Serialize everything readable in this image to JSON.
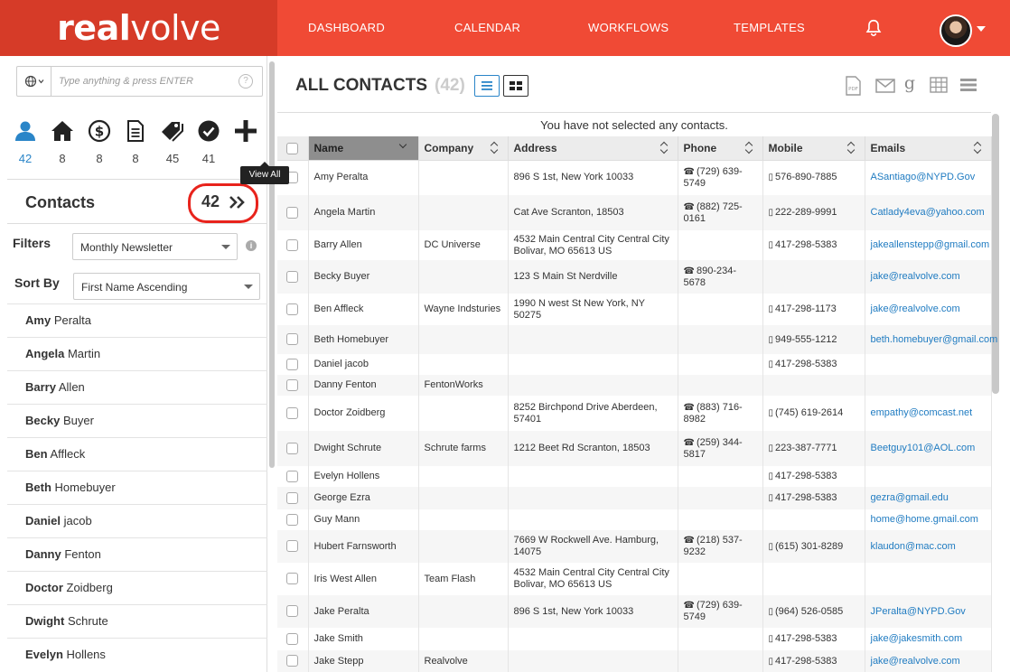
{
  "brand": {
    "logo_bold": "real",
    "logo_light": "volve"
  },
  "nav": {
    "dashboard": "DASHBOARD",
    "calendar": "CALENDAR",
    "workflows": "WORKFLOWS",
    "templates": "TEMPLATES"
  },
  "search": {
    "placeholder": "Type anything & press ENTER",
    "help": "?"
  },
  "categories": [
    {
      "name": "people",
      "count": "42"
    },
    {
      "name": "home",
      "count": "8"
    },
    {
      "name": "dollar",
      "count": "8"
    },
    {
      "name": "document",
      "count": "8"
    },
    {
      "name": "tags",
      "count": "45"
    },
    {
      "name": "check",
      "count": "41"
    }
  ],
  "contacts_panel": {
    "title": "Contacts",
    "count": "42",
    "tooltip": "View All",
    "filters_label": "Filters",
    "filter_value": "Monthly Newsletter",
    "info": "i",
    "sort_label": "Sort By",
    "sort_value": "First Name Ascending",
    "items": [
      {
        "first": "Amy",
        "last": "Peralta"
      },
      {
        "first": "Angela",
        "last": "Martin"
      },
      {
        "first": "Barry",
        "last": "Allen"
      },
      {
        "first": "Becky",
        "last": "Buyer"
      },
      {
        "first": "Ben",
        "last": "Affleck"
      },
      {
        "first": "Beth",
        "last": "Homebuyer"
      },
      {
        "first": "Daniel",
        "last": "jacob"
      },
      {
        "first": "Danny",
        "last": "Fenton"
      },
      {
        "first": "Doctor",
        "last": "Zoidberg"
      },
      {
        "first": "Dwight",
        "last": "Schrute"
      },
      {
        "first": "Evelyn",
        "last": "Hollens"
      }
    ]
  },
  "main": {
    "title": "ALL CONTACTS",
    "count": "(42)",
    "selection_status": "You have not selected any contacts.",
    "columns": [
      "Name",
      "Company",
      "Address",
      "Phone",
      "Mobile",
      "Emails"
    ],
    "rows": [
      {
        "name": "Amy Peralta",
        "company": "",
        "address": "896 S 1st, New York 10033",
        "phone": "(729) 639-5749",
        "mobile": "576-890-7885",
        "email": "ASantiago@NYPD.Gov"
      },
      {
        "name": "Angela Martin",
        "company": "",
        "address": "Cat Ave Scranton, 18503",
        "phone": "(882) 725-0161",
        "mobile": "222-289-9991",
        "email": "Catlady4eva@yahoo.com"
      },
      {
        "name": "Barry Allen",
        "company": "DC Universe",
        "address": "4532 Main Central City Central City Bolivar, MO 65613 US",
        "phone": "",
        "mobile": "417-298-5383",
        "email": "jakeallenstepp@gmail.com"
      },
      {
        "name": "Becky Buyer",
        "company": "",
        "address": "123 S Main St Nerdville",
        "phone": "890-234-5678",
        "mobile": "",
        "email": "jake@realvolve.com"
      },
      {
        "name": "Ben Affleck",
        "company": "Wayne Indsturies",
        "address": "1990 N west St New York, NY 50275",
        "phone": "",
        "mobile": "417-298-1173",
        "email": "jake@realvolve.com"
      },
      {
        "name": "Beth Homebuyer",
        "company": "",
        "address": "",
        "phone": "",
        "mobile": "949-555-1212",
        "email": "beth.homebuyer@gmail.com"
      },
      {
        "name": "Daniel jacob",
        "company": "",
        "address": "",
        "phone": "",
        "mobile": "417-298-5383",
        "email": ""
      },
      {
        "name": "Danny Fenton",
        "company": "FentonWorks",
        "address": "",
        "phone": "",
        "mobile": "",
        "email": ""
      },
      {
        "name": "Doctor Zoidberg",
        "company": "",
        "address": "8252 Birchpond Drive Aberdeen, 57401",
        "phone": "(883) 716-8982",
        "mobile": "(745) 619-2614",
        "email": "empathy@comcast.net"
      },
      {
        "name": "Dwight Schrute",
        "company": "Schrute farms",
        "address": "1212 Beet Rd Scranton, 18503",
        "phone": "(259) 344-5817",
        "mobile": "223-387-7771",
        "email": "Beetguy101@AOL.com"
      },
      {
        "name": "Evelyn Hollens",
        "company": "",
        "address": "",
        "phone": "",
        "mobile": "417-298-5383",
        "email": ""
      },
      {
        "name": "George Ezra",
        "company": "",
        "address": "",
        "phone": "",
        "mobile": "417-298-5383",
        "email": "gezra@gmail.edu"
      },
      {
        "name": "Guy Mann",
        "company": "",
        "address": "",
        "phone": "",
        "mobile": "",
        "email": "home@home.gmail.com"
      },
      {
        "name": "Hubert Farnsworth",
        "company": "",
        "address": "7669 W Rockwell Ave. Hamburg, 14075",
        "phone": "(218) 537-9232",
        "mobile": "(615) 301-8289",
        "email": "klaudon@mac.com"
      },
      {
        "name": "Iris West Allen",
        "company": "Team Flash",
        "address": "4532 Main Central City Central City Bolivar, MO 65613 US",
        "phone": "",
        "mobile": "",
        "email": ""
      },
      {
        "name": "Jake Peralta",
        "company": "",
        "address": "896 S 1st, New York 10033",
        "phone": "(729) 639-5749",
        "mobile": "(964) 526-0585",
        "email": "JPeralta@NYPD.Gov"
      },
      {
        "name": "Jake Smith",
        "company": "",
        "address": "",
        "phone": "",
        "mobile": "417-298-5383",
        "email": "jake@jakesmith.com"
      },
      {
        "name": "Jake Stepp",
        "company": "Realvolve",
        "address": "",
        "phone": "",
        "mobile": "417-298-5383",
        "email": "jake@realvolve.com"
      }
    ]
  },
  "colors": {
    "brand_red": "#f04a35",
    "brand_dark": "#d63b28",
    "link_blue": "#1f7bc1",
    "highlight": "#e8231c"
  }
}
